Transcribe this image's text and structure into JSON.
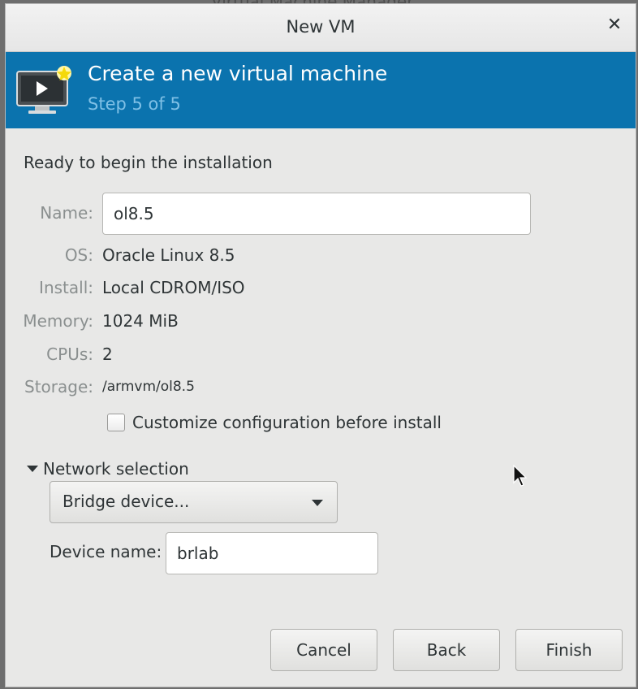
{
  "backdrop": {
    "window_title": "Virtual Machine Manager"
  },
  "dialog": {
    "title": "New VM",
    "close_icon": "close-icon"
  },
  "banner": {
    "icon": "vm-monitor-new-icon",
    "heading": "Create a new virtual machine",
    "step": "Step 5 of 5",
    "background": "#0b73ae"
  },
  "summary": {
    "ready_text": "Ready to begin the installation",
    "name_label": "Name:",
    "name_value": "ol8.5",
    "os_label": "OS:",
    "os_value": "Oracle Linux 8.5",
    "install_label": "Install:",
    "install_value": "Local CDROM/ISO",
    "memory_label": "Memory:",
    "memory_value": "1024 MiB",
    "cpus_label": "CPUs:",
    "cpus_value": "2",
    "storage_label": "Storage:",
    "storage_value": "/armvm/ol8.5"
  },
  "customize": {
    "label": "Customize configuration before install",
    "checked": false
  },
  "network": {
    "expander_label": "Network selection",
    "expanded": true,
    "selected_source": "Bridge device...",
    "device_label": "Device name:",
    "device_value": "brlab"
  },
  "buttons": {
    "cancel": "Cancel",
    "back": "Back",
    "finish": "Finish"
  }
}
